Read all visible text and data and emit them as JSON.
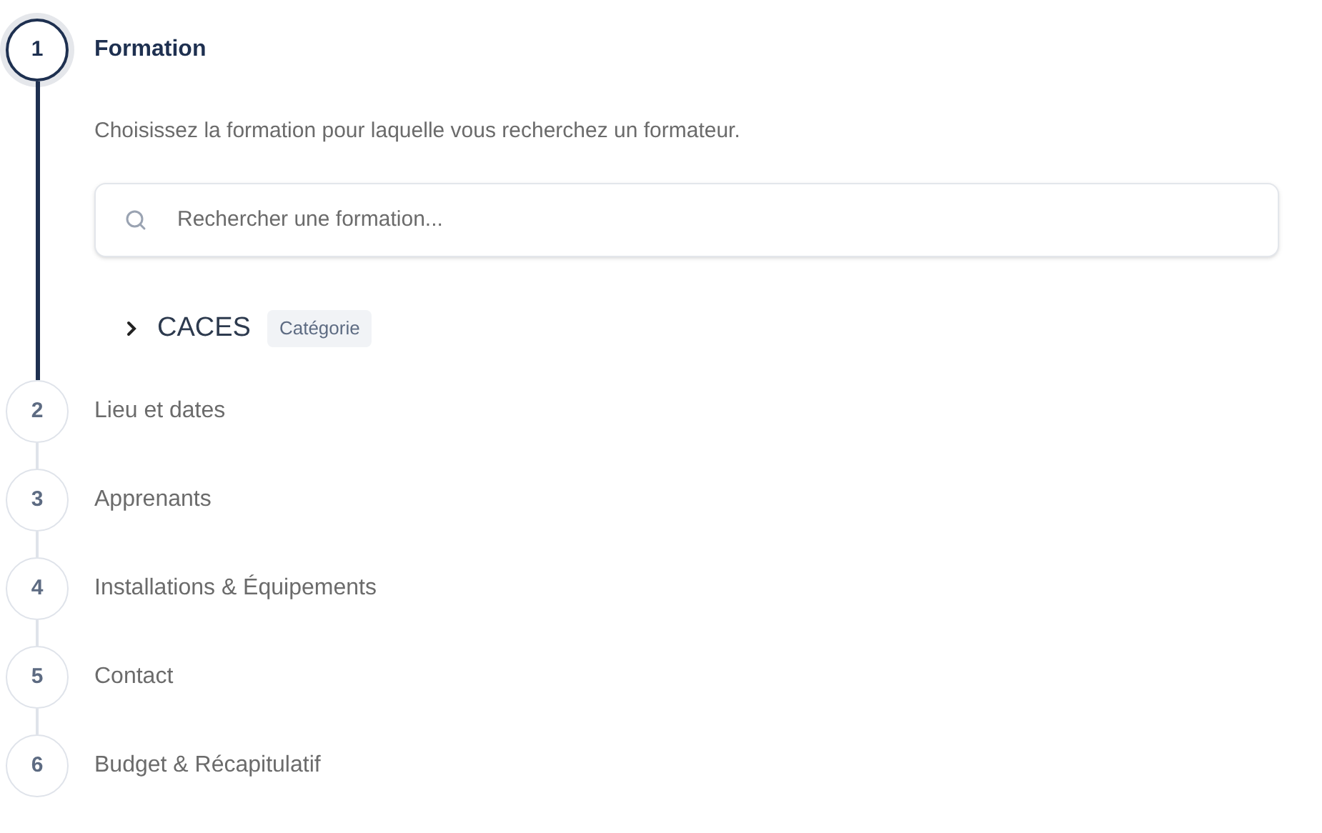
{
  "steps": [
    {
      "number": "1",
      "title": "Formation",
      "selected": true,
      "description": "Choisissez la formation pour laquelle vous recherchez un formateur.",
      "search": {
        "placeholder": "Rechercher une formation..."
      },
      "categories": [
        {
          "name": "CACES",
          "badge": "Catégorie",
          "expanded": false
        }
      ]
    },
    {
      "number": "2",
      "title": "Lieu et dates",
      "selected": false
    },
    {
      "number": "3",
      "title": "Apprenants",
      "selected": false
    },
    {
      "number": "4",
      "title": "Installations & Équipements",
      "selected": false
    },
    {
      "number": "5",
      "title": "Contact",
      "selected": false
    },
    {
      "number": "6",
      "title": "Budget & Récapitulatif",
      "selected": false
    }
  ]
}
